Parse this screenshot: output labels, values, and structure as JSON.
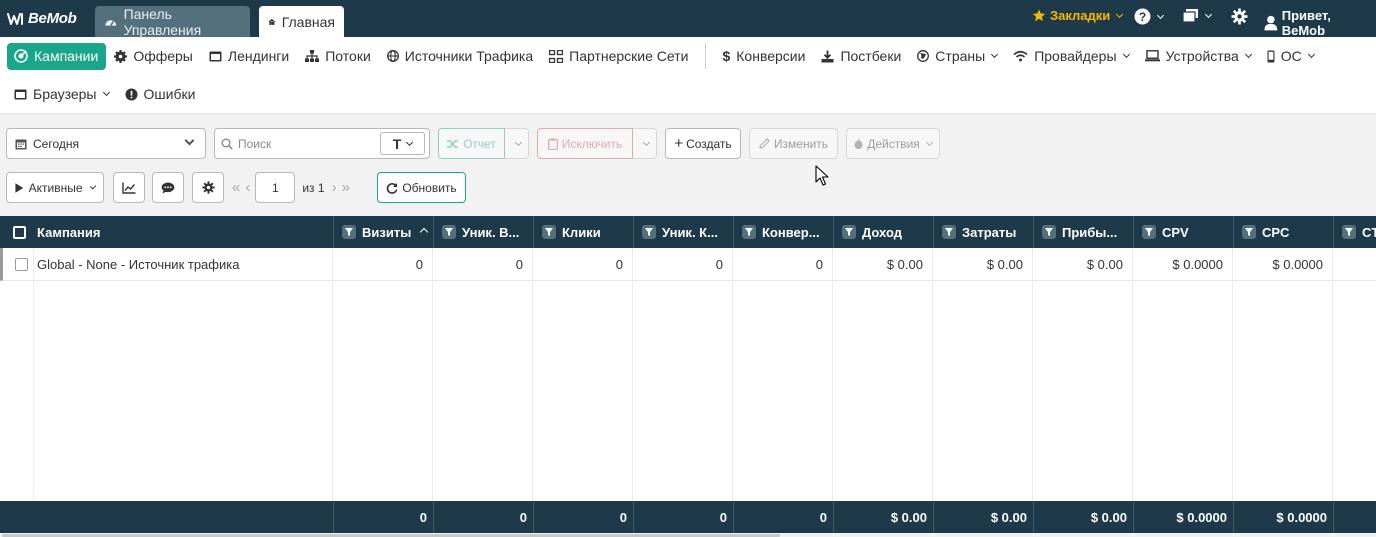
{
  "app": {
    "logo": "BeMob",
    "tabs": [
      {
        "label": "Панель Управления",
        "icon": "dashboard-icon"
      },
      {
        "label": "Главная",
        "icon": "home-icon"
      }
    ],
    "bookmarks_label": "Закладки",
    "greeting": "Привет, BeMob",
    "colors": {
      "header": "#1e3a4a",
      "accent": "#1aa68a",
      "bookmarks": "#f5b800",
      "danger": "#d9534f"
    }
  },
  "nav": {
    "items": [
      {
        "label": "Кампании",
        "icon": "campaigns-icon",
        "active": true
      },
      {
        "label": "Офферы",
        "icon": "offers-icon"
      },
      {
        "label": "Лендинги",
        "icon": "landings-icon"
      },
      {
        "label": "Потоки",
        "icon": "flows-icon"
      },
      {
        "label": "Источники Трафика",
        "icon": "globe-icon"
      },
      {
        "label": "Партнерские Сети",
        "icon": "network-icon"
      },
      {
        "label": "Конверсии",
        "icon": "dollar-icon"
      },
      {
        "label": "Постбеки",
        "icon": "download-icon"
      },
      {
        "label": "Страны",
        "icon": "globe-icon"
      },
      {
        "label": "Провайдеры",
        "icon": "wifi-icon"
      },
      {
        "label": "Устройства",
        "icon": "laptop-icon"
      },
      {
        "label": "ОС",
        "icon": "phone-icon"
      },
      {
        "label": "Браузеры",
        "icon": "browser-icon"
      },
      {
        "label": "Ошибки",
        "icon": "error-icon"
      }
    ]
  },
  "toolbar": {
    "date_range": "Сегодня",
    "search_placeholder": "Поиск",
    "search_mode": "T",
    "report_label": "Отчет",
    "exclude_label": "Исключить",
    "create_label": "Создать",
    "edit_label": "Изменить",
    "actions_label": "Действия",
    "status_filter": "Активные",
    "page": "1",
    "page_of": "из 1",
    "refresh_label": "Обновить"
  },
  "table": {
    "columns": [
      "Кампания",
      "Визиты",
      "Уник. В...",
      "Клики",
      "Уник. К...",
      "Конвер...",
      "Доход",
      "Затраты",
      "Прибы...",
      "CPV",
      "CPC",
      "CTR"
    ],
    "rows": [
      [
        "Global - None - Источник трафика",
        "0",
        "0",
        "0",
        "0",
        "0",
        "$ 0.00",
        "$ 0.00",
        "$ 0.00",
        "$ 0.0000",
        "$ 0.0000",
        ""
      ]
    ],
    "totals": [
      "",
      "0",
      "0",
      "0",
      "0",
      "0",
      "$ 0.00",
      "$ 0.00",
      "$ 0.00",
      "$ 0.0000",
      "$ 0.0000",
      ""
    ]
  }
}
